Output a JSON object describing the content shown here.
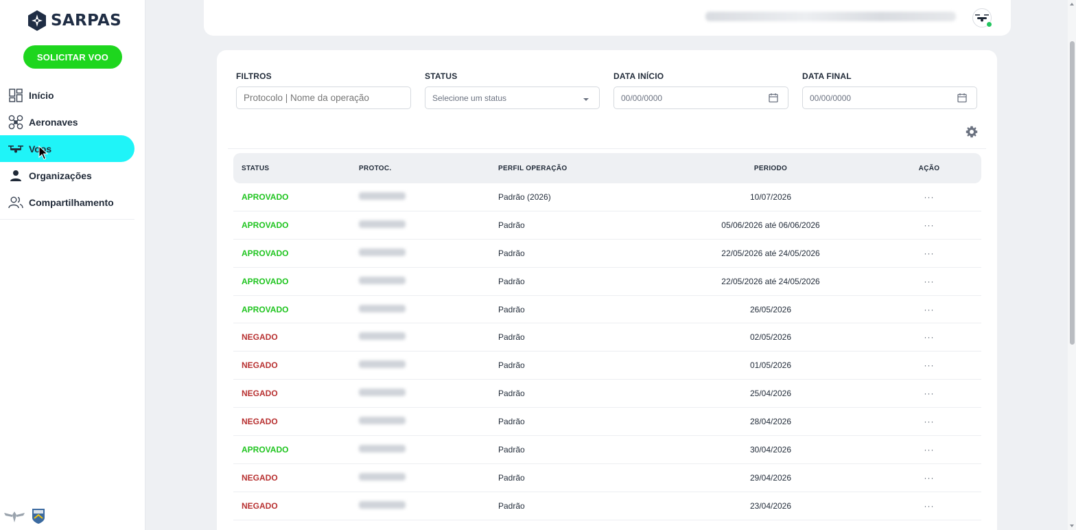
{
  "app": {
    "brand": "SARPAS"
  },
  "sidebar": {
    "cta_label": "SOLICITAR VOO",
    "items": [
      {
        "label": "Início",
        "icon": "dashboard-icon",
        "active": false
      },
      {
        "label": "Aeronaves",
        "icon": "drone-icon",
        "active": false
      },
      {
        "label": "Voos",
        "icon": "flight-drone-icon",
        "active": true
      },
      {
        "label": "Organizações",
        "icon": "person-icon",
        "active": false
      },
      {
        "label": "Compartilhamento",
        "icon": "people-icon",
        "active": false
      }
    ]
  },
  "filters": {
    "filtros": {
      "label": "FILTROS",
      "placeholder": "Protocolo | Nome da operação"
    },
    "status": {
      "label": "STATUS",
      "value": "Selecione um status"
    },
    "data_inicio": {
      "label": "DATA INÍCIO",
      "value": "00/00/0000"
    },
    "data_final": {
      "label": "DATA FINAL",
      "value": "00/00/0000"
    }
  },
  "table": {
    "headers": {
      "status": "STATUS",
      "protocolo": "PROTOC.",
      "perfil": "PERFIL OPERAÇÃO",
      "periodo": "PERIODO",
      "acao": "AÇÃO"
    },
    "action_label": "···",
    "rows": [
      {
        "status": "APROVADO",
        "perfil": "Padrão (2026)",
        "periodo": "10/07/2026"
      },
      {
        "status": "APROVADO",
        "perfil": "Padrão",
        "periodo": "05/06/2026 até 06/06/2026"
      },
      {
        "status": "APROVADO",
        "perfil": "Padrão",
        "periodo": "22/05/2026 até 24/05/2026"
      },
      {
        "status": "APROVADO",
        "perfil": "Padrão",
        "periodo": "22/05/2026 até 24/05/2026"
      },
      {
        "status": "APROVADO",
        "perfil": "Padrão",
        "periodo": "26/05/2026"
      },
      {
        "status": "NEGADO",
        "perfil": "Padrão",
        "periodo": "02/05/2026"
      },
      {
        "status": "NEGADO",
        "perfil": "Padrão",
        "periodo": "01/05/2026"
      },
      {
        "status": "NEGADO",
        "perfil": "Padrão",
        "periodo": "25/04/2026"
      },
      {
        "status": "NEGADO",
        "perfil": "Padrão",
        "periodo": "28/04/2026"
      },
      {
        "status": "APROVADO",
        "perfil": "Padrão",
        "periodo": "30/04/2026"
      },
      {
        "status": "NEGADO",
        "perfil": "Padrão",
        "periodo": "29/04/2026"
      },
      {
        "status": "NEGADO",
        "perfil": "Padrão",
        "periodo": "23/04/2026"
      }
    ]
  },
  "colors": {
    "brand_navy": "#1f2d44",
    "cta_green": "#1ed61e",
    "active_cyan": "#1ff4f8",
    "approved": "#1fc41f",
    "denied": "#b83232"
  }
}
